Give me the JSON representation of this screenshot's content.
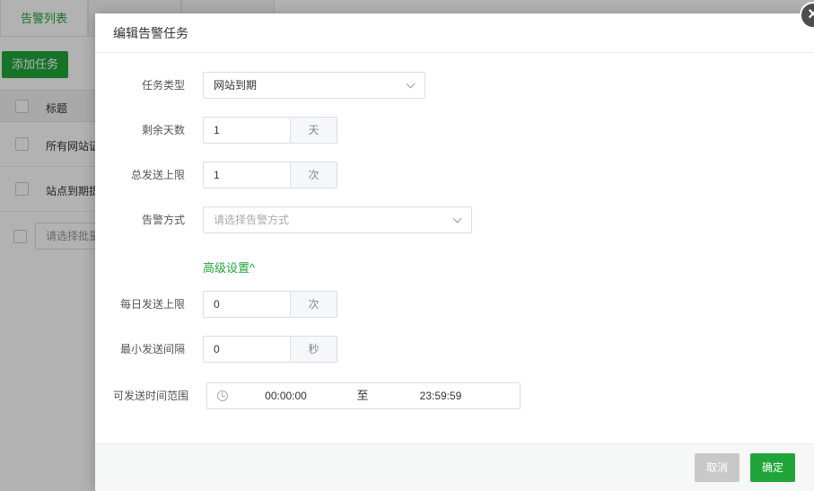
{
  "background": {
    "tabs": [
      "告警列表",
      "",
      ""
    ],
    "add_button": "添加任务",
    "table_header": "标题",
    "rows": [
      "所有网站证",
      "站点到期提"
    ],
    "batch_placeholder": "请选择批量"
  },
  "dialog": {
    "title": "编辑告警任务",
    "close_symbol": "×",
    "task_type": {
      "label": "任务类型",
      "value": "网站到期"
    },
    "days_left": {
      "label": "剩余天数",
      "value": "1",
      "unit": "天"
    },
    "total_limit": {
      "label": "总发送上限",
      "value": "1",
      "unit": "次"
    },
    "alert_method": {
      "label": "告警方式",
      "placeholder": "请选择告警方式"
    },
    "advanced_toggle": "高级设置^",
    "daily_limit": {
      "label": "每日发送上限",
      "value": "0",
      "unit": "次"
    },
    "min_interval": {
      "label": "最小发送间隔",
      "value": "0",
      "unit": "秒"
    },
    "time_range": {
      "label": "可发送时间范围",
      "start": "00:00:00",
      "separator": "至",
      "end": "23:59:59"
    },
    "footer": {
      "cancel": "取消",
      "confirm": "确定"
    }
  },
  "colors": {
    "accent": "#20a53a",
    "mask": "rgba(0,0,0,0.3)",
    "disabled": "#c8c8c8"
  }
}
